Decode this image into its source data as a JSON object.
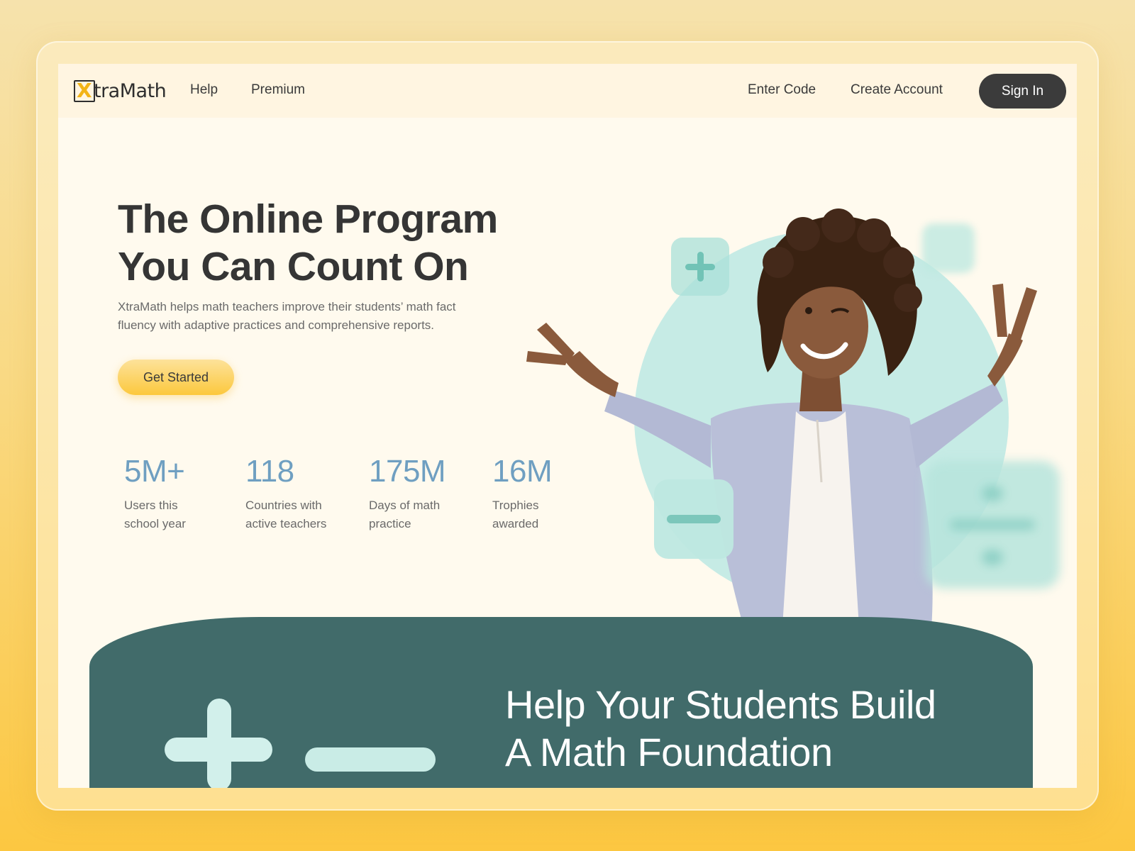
{
  "nav": {
    "logo_mark": "X",
    "logo_text": "traMath",
    "help": "Help",
    "premium": "Premium",
    "enter_code": "Enter Code",
    "create_account": "Create Account",
    "sign_in": "Sign In"
  },
  "hero": {
    "title_line1": "The Online Program",
    "title_line2": "You Can Count On",
    "subtitle_line1": "XtraMath helps math teachers improve their students’ math fact",
    "subtitle_line2": "fluency with adaptive practices and comprehensive reports.",
    "cta": "Get Started"
  },
  "stats": [
    {
      "value": "5M+",
      "label_line1": "Users this",
      "label_line2": "school year"
    },
    {
      "value": "118",
      "label_line1": "Countries with",
      "label_line2": "active teachers"
    },
    {
      "value": "175M",
      "label_line1": "Days of math",
      "label_line2": "practice"
    },
    {
      "value": "16M",
      "label_line1": "Trophies",
      "label_line2": "awarded"
    }
  ],
  "section": {
    "title_line1": "Help Your Students Build",
    "title_line2": "A Math Foundation"
  },
  "icons": [
    "plus-icon",
    "minus-icon",
    "equals-icon",
    "divide-icon"
  ],
  "colors": {
    "accent_yellow": "#fcc83d",
    "stat_blue": "#6f9fc1",
    "teal_band": "#416b6a",
    "mint": "#c6ebe5",
    "dark_button": "#3b3b3b"
  }
}
